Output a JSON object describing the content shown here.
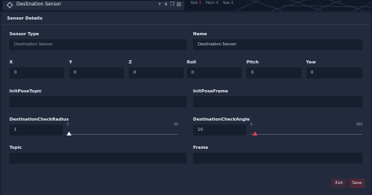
{
  "topbar": {
    "entry_name": "Destination Sensor",
    "readout": {
      "roll_label": "Roll:",
      "roll_value": "0",
      "pitch_label": "Pitch:",
      "pitch_value": "0",
      "yaw_label": "Yaw:",
      "yaw_value": "0"
    }
  },
  "panel": {
    "title": "Sensor Details",
    "sensor_type": {
      "label": "Sensor Type",
      "value": "Destination Sensor"
    },
    "name": {
      "label": "Name",
      "value": "Destination Sensor"
    },
    "x": {
      "label": "X",
      "value": "0"
    },
    "y": {
      "label": "Y",
      "value": "0"
    },
    "z": {
      "label": "Z",
      "value": "0"
    },
    "roll": {
      "label": "Roll",
      "value": "0"
    },
    "pitch": {
      "label": "Pitch",
      "value": "0"
    },
    "yaw": {
      "label": "Yaw",
      "value": "0"
    },
    "init_pose_topic": {
      "label": "InitPoseTopic",
      "value": ""
    },
    "init_pose_frame": {
      "label": "InitPoseFrame",
      "value": ""
    },
    "check_radius": {
      "label": "DestinationCheckRadius",
      "value": "1",
      "min": "1",
      "max": "10",
      "level": 0.0
    },
    "check_angle": {
      "label": "DestinationCheckAngle",
      "value": "10",
      "min": "1",
      "max": "360",
      "level": 0.025
    },
    "topic": {
      "label": "Topic",
      "value": ""
    },
    "frame": {
      "label": "Frame",
      "value": ""
    },
    "exit_label": "Exit",
    "save_label": "Save"
  }
}
